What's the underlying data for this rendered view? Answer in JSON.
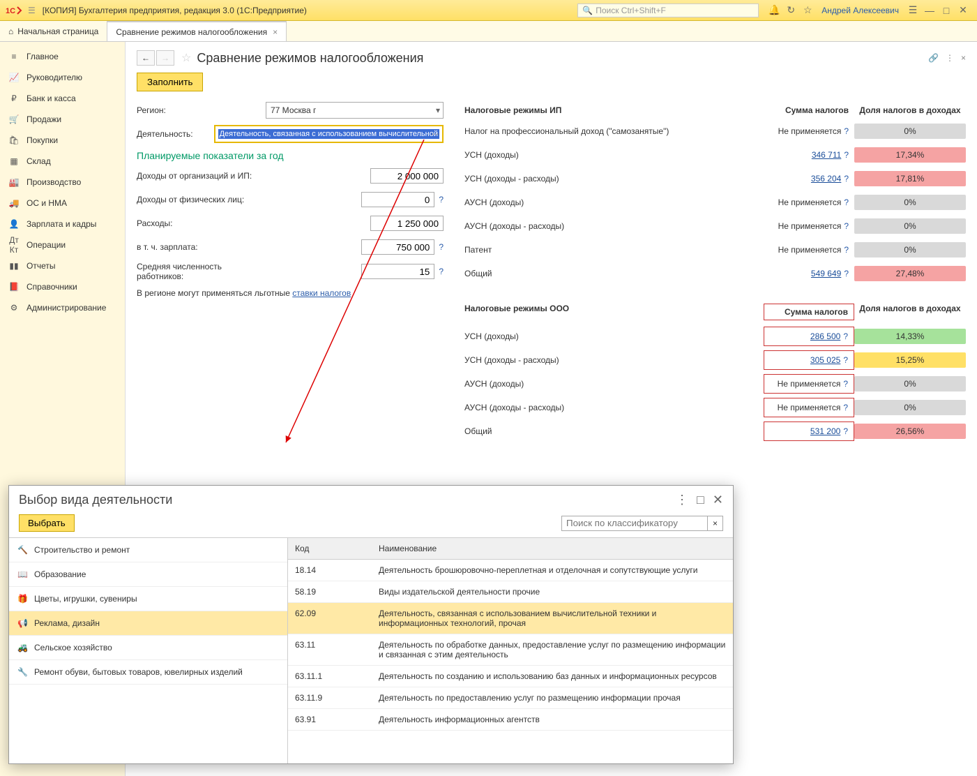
{
  "titlebar": {
    "app_title": "[КОПИЯ] Бухгалтерия предприятия, редакция 3.0  (1С:Предприятие)",
    "search_placeholder": "Поиск Ctrl+Shift+F",
    "user": "Андрей Алексеевич"
  },
  "tabs": {
    "home": "Начальная страница",
    "compare": "Сравнение режимов налогообложения"
  },
  "sidebar": {
    "items": [
      "Главное",
      "Руководителю",
      "Банк и касса",
      "Продажи",
      "Покупки",
      "Склад",
      "Производство",
      "ОС и НМА",
      "Зарплата и кадры",
      "Операции",
      "Отчеты",
      "Справочники",
      "Администрирование"
    ]
  },
  "page": {
    "title": "Сравнение режимов налогообложения",
    "fill_btn": "Заполнить",
    "region_label": "Регион:",
    "region_value": "77 Москва г",
    "activity_label": "Деятельность:",
    "activity_value": "Деятельность, связанная с использованием вычислительной",
    "section": "Планируемые показатели за год",
    "income_org": "Доходы от организаций и ИП:",
    "income_org_val": "2 000 000",
    "income_ind": "Доходы от физических лиц:",
    "income_ind_val": "0",
    "expenses": "Расходы:",
    "expenses_val": "1 250 000",
    "salary": "в т. ч. зарплата:",
    "salary_val": "750 000",
    "headcount": "Средняя численность работников:",
    "headcount_val": "15",
    "note_prefix": "В регионе могут применяться льготные ",
    "note_link": "ставки налогов"
  },
  "tables": {
    "ip_header": "Налоговые режимы ИП",
    "ooo_header": "Налоговые режимы ООО",
    "sum_header": "Сумма налогов",
    "share_header": "Доля налогов в доходах",
    "na": "Не применяется",
    "ip": [
      {
        "name": "Налог на профессиональный доход (\"самозанятые\")",
        "sum": "",
        "na": true,
        "share": "0%",
        "color": "grey"
      },
      {
        "name": "УСН (доходы)",
        "sum": "346 711",
        "na": false,
        "share": "17,34%",
        "color": "red"
      },
      {
        "name": "УСН (доходы - расходы)",
        "sum": "356 204",
        "na": false,
        "share": "17,81%",
        "color": "red"
      },
      {
        "name": "АУСН (доходы)",
        "sum": "",
        "na": true,
        "share": "0%",
        "color": "grey"
      },
      {
        "name": "АУСН (доходы - расходы)",
        "sum": "",
        "na": true,
        "share": "0%",
        "color": "grey"
      },
      {
        "name": "Патент",
        "sum": "",
        "na": true,
        "share": "0%",
        "color": "grey"
      },
      {
        "name": "Общий",
        "sum": "549 649",
        "na": false,
        "share": "27,48%",
        "color": "red"
      }
    ],
    "ooo": [
      {
        "name": "УСН (доходы)",
        "sum": "286 500",
        "na": false,
        "share": "14,33%",
        "color": "green"
      },
      {
        "name": "УСН (доходы - расходы)",
        "sum": "305 025",
        "na": false,
        "share": "15,25%",
        "color": "yellow"
      },
      {
        "name": "АУСН (доходы)",
        "sum": "",
        "na": true,
        "share": "0%",
        "color": "grey"
      },
      {
        "name": "АУСН (доходы - расходы)",
        "sum": "",
        "na": true,
        "share": "0%",
        "color": "grey"
      },
      {
        "name": "Общий",
        "sum": "531 200",
        "na": false,
        "share": "26,56%",
        "color": "red"
      }
    ]
  },
  "dialog": {
    "title": "Выбор вида деятельности",
    "choose": "Выбрать",
    "search_placeholder": "Поиск по классификатору",
    "categories": [
      "Строительство и ремонт",
      "Образование",
      "Цветы, игрушки, сувениры",
      "Реклама, дизайн",
      "Сельское хозяйство",
      "Ремонт обуви, бытовых товаров, ювелирных изделий"
    ],
    "th_code": "Код",
    "th_name": "Наименование",
    "rows": [
      {
        "code": "18.14",
        "name": "Деятельность брошюровочно-переплетная и отделочная и сопутствующие услуги"
      },
      {
        "code": "58.19",
        "name": "Виды издательской деятельности прочие"
      },
      {
        "code": "62.09",
        "name": "Деятельность, связанная с использованием вычислительной техники и информационных технологий, прочая"
      },
      {
        "code": "63.11",
        "name": "Деятельность по обработке данных, предоставление услуг по размещению информации и связанная с этим деятельность"
      },
      {
        "code": "63.11.1",
        "name": "Деятельность по созданию и использованию баз данных и информационных ресурсов"
      },
      {
        "code": "63.11.9",
        "name": "Деятельность по предоставлению услуг по размещению информации прочая"
      },
      {
        "code": "63.91",
        "name": "Деятельность информационных агентств"
      }
    ]
  }
}
